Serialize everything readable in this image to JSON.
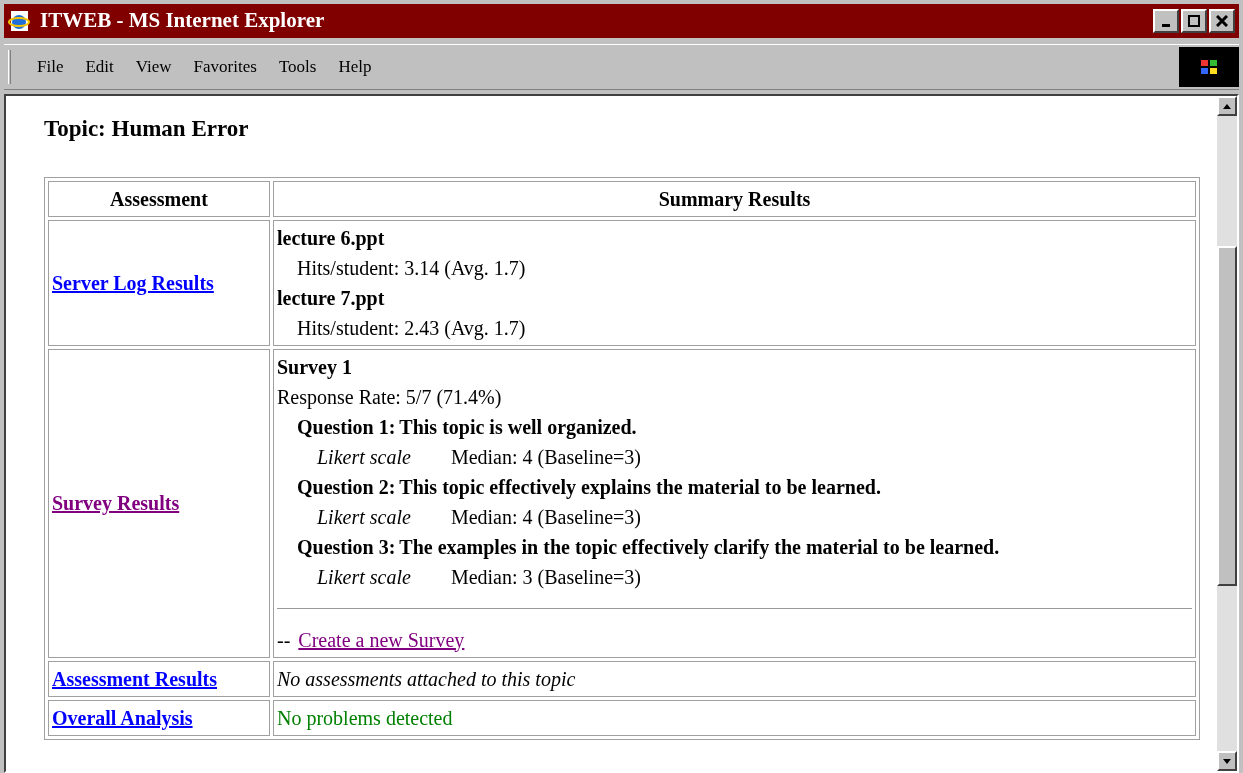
{
  "window": {
    "title": "ITWEB - MS Internet Explorer"
  },
  "menu": [
    "File",
    "Edit",
    "View",
    "Favorites",
    "Tools",
    "Help"
  ],
  "page": {
    "heading": "Topic: Human Error",
    "table": {
      "columns": [
        "Assessment",
        "Summary Results"
      ],
      "rows": [
        {
          "link": {
            "label": "Server Log Results",
            "visited": false
          },
          "kind": "files",
          "files": [
            {
              "name": "lecture 6.ppt",
              "stat": "Hits/student: 3.14 (Avg. 1.7)"
            },
            {
              "name": "lecture 7.ppt",
              "stat": "Hits/student: 2.43 (Avg. 1.7)"
            }
          ]
        },
        {
          "link": {
            "label": "Survey Results",
            "visited": true
          },
          "kind": "survey",
          "survey": {
            "title": "Survey 1",
            "response_rate": "Response Rate: 5/7 (71.4%)",
            "questions": [
              {
                "label": "Question 1:",
                "text": "This topic is well organized.",
                "scale": "Likert scale",
                "median": "Median: 4 (Baseline=3)"
              },
              {
                "label": "Question 2:",
                "text": "This topic effectively explains the material to be learned.",
                "scale": "Likert scale",
                "median": "Median: 4 (Baseline=3)"
              },
              {
                "label": "Question 3:",
                "text": "The examples in the topic effectively clarify the material to be learned.",
                "scale": "Likert scale",
                "median": "Median: 3 (Baseline=3)"
              }
            ],
            "action_prefix": "--",
            "action": {
              "label": "Create a new Survey",
              "visited": true
            }
          }
        },
        {
          "link": {
            "label": "Assessment Results",
            "visited": false
          },
          "kind": "note",
          "text": "No assessments attached to this topic"
        },
        {
          "link": {
            "label": "Overall Analysis",
            "visited": false
          },
          "kind": "status",
          "text": "No problems detected",
          "color": "#008000"
        }
      ]
    }
  }
}
